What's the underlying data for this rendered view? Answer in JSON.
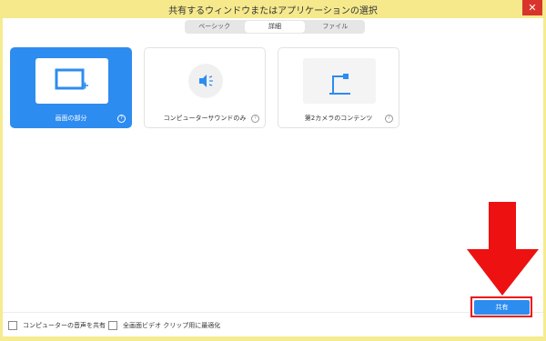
{
  "window": {
    "title": "共有するウィンドウまたはアプリケーションの選択"
  },
  "tabs": [
    {
      "label": "ベーシック"
    },
    {
      "label": "詳細"
    },
    {
      "label": "ファイル"
    }
  ],
  "cards": [
    {
      "label": "画面の部分",
      "icon": "screen-portion-icon"
    },
    {
      "label": "コンピューターサウンドのみ",
      "icon": "speaker-icon"
    },
    {
      "label": "第2カメラのコンテンツ",
      "icon": "document-camera-icon"
    }
  ],
  "options": {
    "share_sound": "コンピューターの音声を共有",
    "optimize_video": "全画面ビデオ クリップ用に最適化"
  },
  "share_button": {
    "label": "共有"
  },
  "colors": {
    "accent": "#2d8cf0",
    "annotation": "#ee1111"
  }
}
